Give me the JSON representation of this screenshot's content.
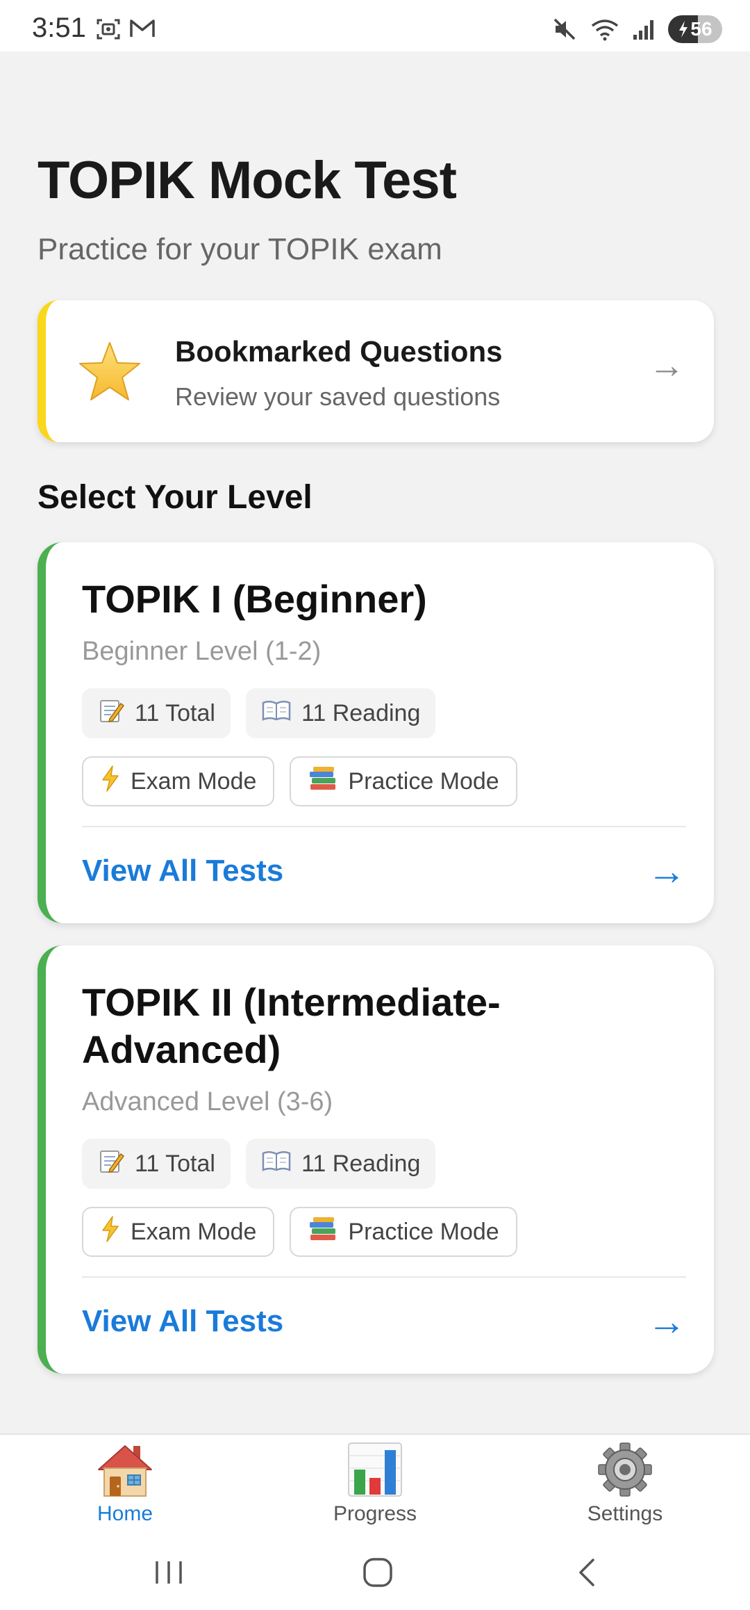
{
  "status_bar": {
    "time": "3:51",
    "battery": "56"
  },
  "header": {
    "title": "TOPIK Mock Test",
    "subtitle": "Practice for your TOPIK exam"
  },
  "bookmarks": {
    "title": "Bookmarked Questions",
    "description": "Review your saved questions",
    "arrow": "→",
    "accent_color": "#f9d71c"
  },
  "section_title": "Select Your Level",
  "levels": [
    {
      "title": "TOPIK I (Beginner)",
      "subtitle": "Beginner Level (1-2)",
      "total": "11 Total",
      "reading": "11 Reading",
      "exam_mode": "Exam Mode",
      "practice_mode": "Practice Mode",
      "view_all": "View All Tests",
      "arrow": "→"
    },
    {
      "title": "TOPIK II (Intermediate-Advanced)",
      "subtitle": "Advanced Level (3-6)",
      "total": "11 Total",
      "reading": "11 Reading",
      "exam_mode": "Exam Mode",
      "practice_mode": "Practice Mode",
      "view_all": "View All Tests",
      "arrow": "→"
    }
  ],
  "level_accent_color": "#4caf50",
  "link_color": "#1a7bd9",
  "bottom_nav": {
    "home": "Home",
    "progress": "Progress",
    "settings": "Settings",
    "active": "home"
  },
  "icons": {
    "bookmark": "star-icon",
    "total": "memo-icon",
    "reading": "open-book-icon",
    "exam": "lightning-icon",
    "practice": "books-icon",
    "home": "house-icon",
    "progress": "bar-chart-icon",
    "settings": "gear-icon"
  }
}
